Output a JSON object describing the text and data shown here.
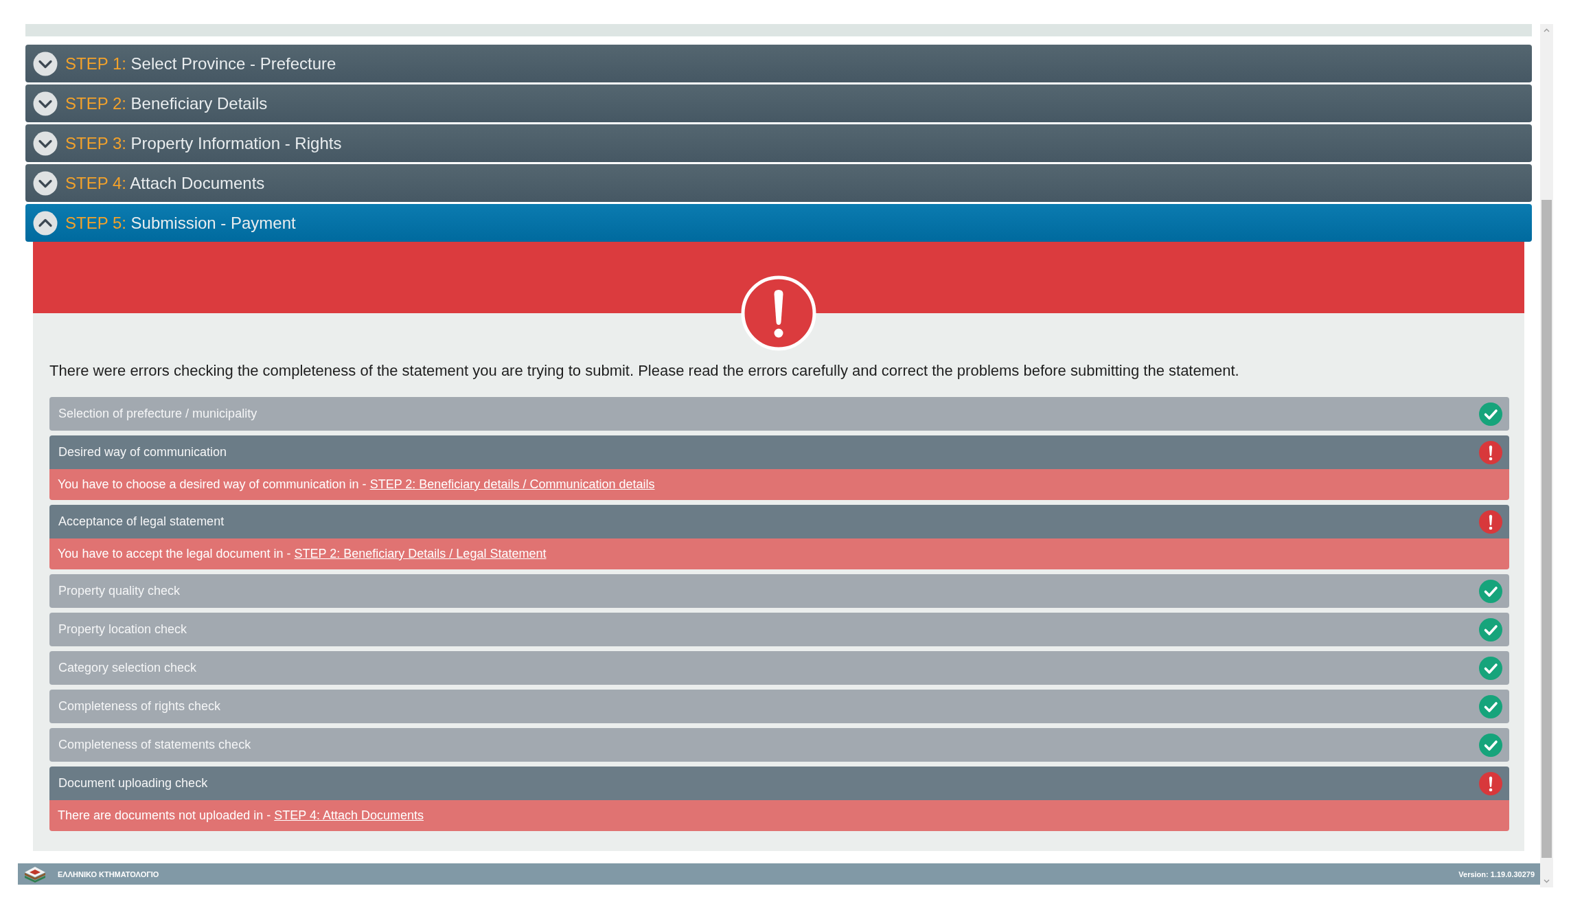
{
  "steps": [
    {
      "label": "STEP 1:",
      "title": "Select Province - Prefecture",
      "expanded": false
    },
    {
      "label": "STEP 2:",
      "title": "Beneficiary Details",
      "expanded": false
    },
    {
      "label": "STEP 3:",
      "title": "Property Information - Rights",
      "expanded": false
    },
    {
      "label": "STEP 4:",
      "title": "Attach Documents",
      "expanded": false
    },
    {
      "label": "STEP 5:",
      "title": "Submission - Payment",
      "expanded": true,
      "panel": {
        "message": "There were errors checking the completeness of the statement you are trying to submit. Please read the errors carefully and correct the problems before submitting the statement.",
        "checks": [
          {
            "title": "Selection of prefecture / municipality",
            "passed": true
          },
          {
            "title": "Desired way of communication",
            "passed": false,
            "error": {
              "text": "You have to choose a desired way of communication in -",
              "link": "STEP 2: Beneficiary details / Communication details"
            }
          },
          {
            "title": "Acceptance of legal statement",
            "passed": false,
            "error": {
              "text": "You have to accept the legal document in -",
              "link": "STEP 2: Beneficiary Details / Legal Statement"
            }
          },
          {
            "title": "Property quality check",
            "passed": true
          },
          {
            "title": "Property location check",
            "passed": true
          },
          {
            "title": "Category selection check",
            "passed": true
          },
          {
            "title": "Completeness of rights check",
            "passed": true
          },
          {
            "title": "Completeness of statements check",
            "passed": true
          },
          {
            "title": "Document uploading check",
            "passed": false,
            "error": {
              "text": "There are documents not uploaded in -",
              "link": "STEP 4: Attach Documents"
            }
          }
        ]
      }
    }
  ],
  "footer": {
    "brand": "ΕΛΛΗΝΙΚΟ ΚΤΗΜΑΤΟΛΟΓΙΟ",
    "version": "Version: 1.19.0.30279"
  }
}
